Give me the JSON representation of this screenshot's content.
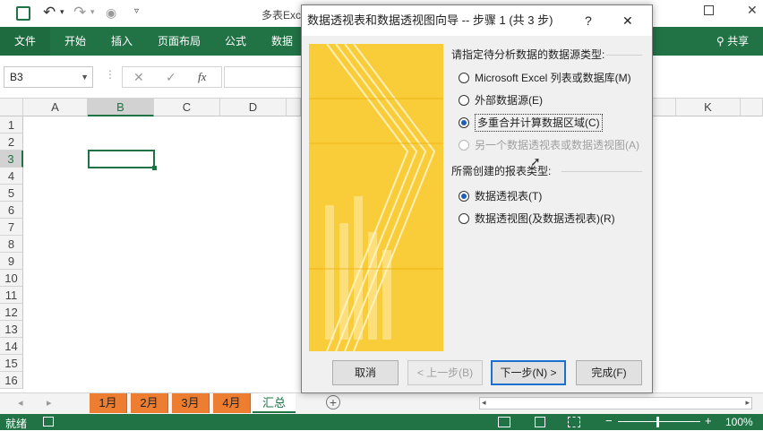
{
  "window": {
    "title": "多表Exce"
  },
  "ribbon": {
    "tabs": [
      "文件",
      "开始",
      "插入",
      "页面布局",
      "公式",
      "数据"
    ],
    "share_label": "共享"
  },
  "formula_bar": {
    "name_box": "B3",
    "fx_label": "fx"
  },
  "grid": {
    "columns": [
      "A",
      "B",
      "C",
      "D",
      "K"
    ],
    "rows": [
      "1",
      "2",
      "3",
      "4",
      "5",
      "6",
      "7",
      "8",
      "9",
      "10",
      "11",
      "12",
      "13",
      "14",
      "15",
      "16"
    ],
    "selected_cell": "B3"
  },
  "sheets": {
    "tabs": [
      "1月",
      "2月",
      "3月",
      "4月",
      "汇总"
    ],
    "active": "汇总",
    "tab_color": "#ed7d31"
  },
  "status": {
    "ready": "就绪",
    "zoom": "100%"
  },
  "dialog": {
    "title": "数据透视表和数据透视图向导 -- 步骤 1 (共 3 步)",
    "help": "?",
    "close": "✕",
    "source_group_label": "请指定待分析数据的数据源类型:",
    "source_options": [
      {
        "label": "Microsoft Excel 列表或数据库(M)",
        "selected": false,
        "enabled": true
      },
      {
        "label": "外部数据源(E)",
        "selected": false,
        "enabled": true
      },
      {
        "label": "多重合并计算数据区域(C)",
        "selected": true,
        "enabled": true
      },
      {
        "label": "另一个数据透视表或数据透视图(A)",
        "selected": false,
        "enabled": false
      }
    ],
    "report_group_label": "所需创建的报表类型:",
    "report_options": [
      {
        "label": "数据透视表(T)",
        "selected": true
      },
      {
        "label": "数据透视图(及数据透视表)(R)",
        "selected": false
      }
    ],
    "buttons": {
      "cancel": "取消",
      "back": "< 上一步(B)",
      "next": "下一步(N) >",
      "finish": "完成(F)"
    }
  },
  "colors": {
    "excel_green": "#217346",
    "accent": "#1a5fb4",
    "banner": "#f7c320"
  }
}
